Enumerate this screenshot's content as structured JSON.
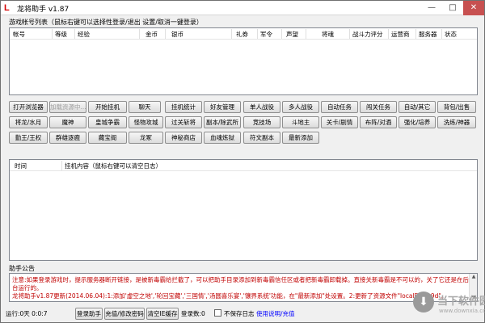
{
  "window": {
    "title": "龙将助手 v1.87",
    "icon": "L",
    "controls": [
      "—",
      "□",
      "✕"
    ]
  },
  "accounts": {
    "label": "游戏帐号列表（鼠标右键可以选择性登录/退出 设置/取消一键登录）",
    "columns": [
      "帐号",
      "等级",
      "经验",
      "金币",
      "银币",
      "礼券",
      "军令",
      "声望",
      "将魂",
      "战斗力评分",
      "运营商",
      "服务器",
      "状态"
    ]
  },
  "buttons": {
    "row1": [
      "打开浏览器",
      "加载资源中...",
      "开始挂机",
      "聊天",
      "挂机统计",
      "好友管理",
      "单人战役",
      "多人战役",
      "自动任务",
      "闯关任务",
      "自动/其它",
      "背包/出售"
    ],
    "row2": [
      "将龙/水月",
      "魔神",
      "皇城争霸",
      "怪物攻城",
      "过关斩将",
      "副本/除武所",
      "竞技场",
      "斗地主",
      "关卡/剧情",
      "布阵/对酒",
      "强化/培养",
      "洗练/神器"
    ],
    "row3": [
      "勤王/王权",
      "群雄逐鹿",
      "藏宝阁",
      "龙冢",
      "神秘商店",
      "血魂炼狱",
      "符文副本",
      "最新添加"
    ]
  },
  "log": {
    "columns": [
      "时间",
      "挂机内容（鼠标右键可以清空日志）"
    ]
  },
  "notice": {
    "label": "助手公告",
    "line1": "注意:如果登录游戏时，提示服务器断开链接，是被新毒霸给拦截了，可以把助手目录添加到新毒霸信任区或者把新毒霸卸载掉。直接关新毒霸是不可以的，关了它还是在后",
    "line2": "台运行的。",
    "line3": "龙将助手v1.87更新(2014.06.04):1:添加'虚空之地','轮回宝藏','三国情','汤圆喜乐宴','镶界系统'功能，在\"最新添加\"处设置。2:更新了资源文件\"localData.9d\"。"
  },
  "status": {
    "runtime": "运行:0天 0:0:7",
    "login_button": "登录助手",
    "recharge_button": "充值/修改密码",
    "clear_cache_button": "清空IE缓存",
    "login_count": "登录数:0",
    "no_save_log": "不保存日志",
    "help_link": "使用说明/充值"
  },
  "watermark": {
    "logo": "⬇",
    "text": "当下软件园",
    "sub": "www.downxia.com"
  },
  "colors": {
    "notice_text": "#c00000",
    "link": "#0000ff",
    "disabled": "#a0a0a0"
  }
}
